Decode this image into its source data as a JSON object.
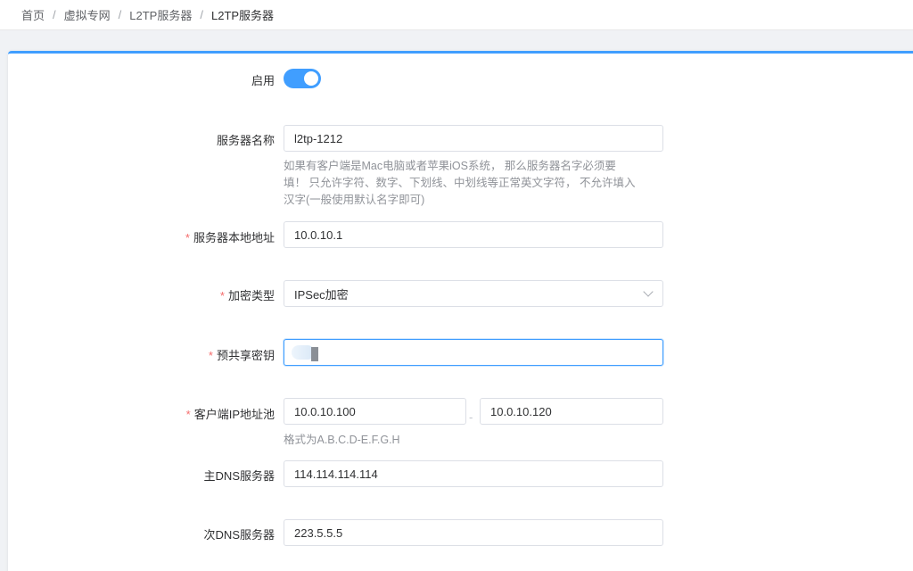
{
  "breadcrumb": [
    "首页",
    "虚拟专网",
    "L2TP服务器",
    "L2TP服务器"
  ],
  "breadcrumb_separator": "/",
  "form": {
    "enable_label": "启用",
    "enable_state": true,
    "server_name_label": "服务器名称",
    "server_name_value": "l2tp-1212",
    "server_name_help": [
      "如果有客户端是Mac电脑或者苹果iOS系统， 那么服务器名字必须要",
      "填！ 只允许字符、数字、下划线、中划线等正常英文字符， 不允许填入",
      "汉字(一般使用默认名字即可)"
    ],
    "local_addr_label": "服务器本地地址",
    "local_addr_value": "10.0.10.1",
    "encrypt_label": "加密类型",
    "encrypt_value": "IPSec加密",
    "psk_label": "预共享密钥",
    "pool_label": "客户端IP地址池",
    "pool_start": "10.0.10.100",
    "pool_dash": "-",
    "pool_end": "10.0.10.120",
    "pool_help": "格式为A.B.C.D-E.F.G.H",
    "dns1_label": "主DNS服务器",
    "dns1_value": "114.114.114.114",
    "dns2_label": "次DNS服务器",
    "dns2_value": "223.5.5.5",
    "required_mark": "*"
  },
  "colors": {
    "accent": "#409eff",
    "required": "#f56c6c"
  }
}
